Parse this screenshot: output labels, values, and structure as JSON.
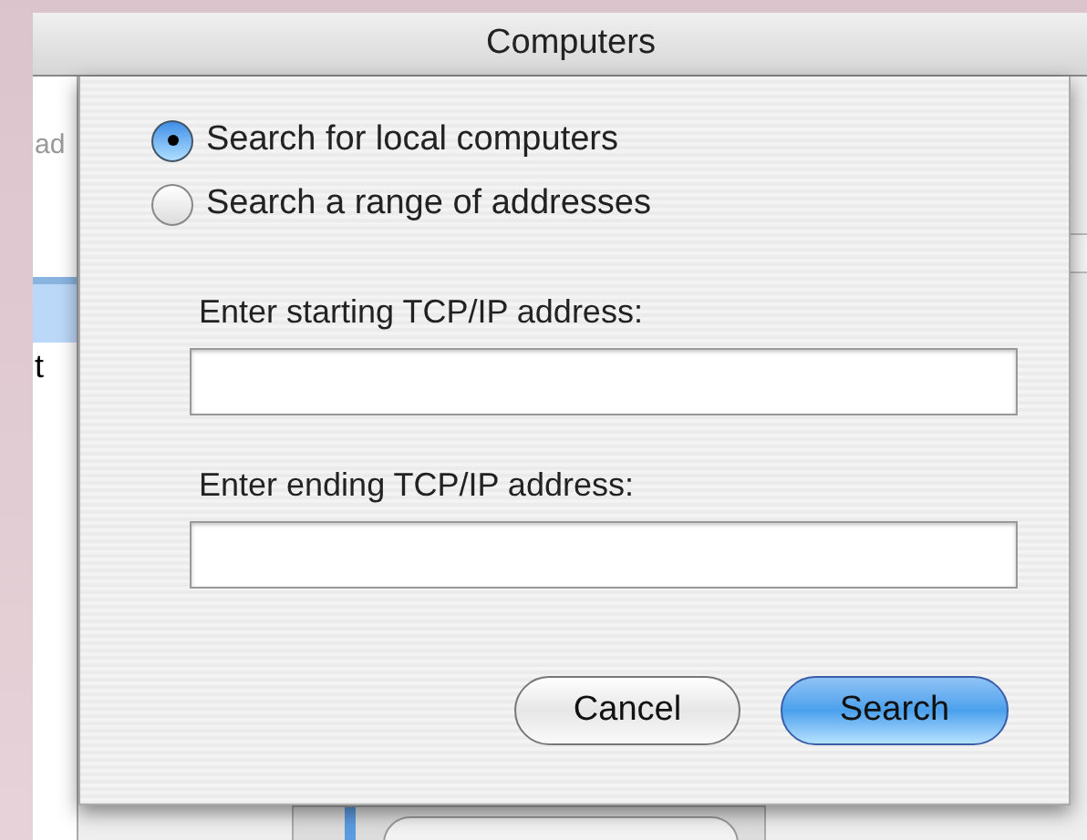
{
  "window": {
    "title": "Computers"
  },
  "background_window": {
    "left_column": {
      "header_text": "ad",
      "rows": [
        {
          "selected": true
        },
        {
          "selected": false,
          "text": "t"
        }
      ]
    }
  },
  "sheet": {
    "options": [
      {
        "label": "Search for local computers",
        "selected": true
      },
      {
        "label": "Search a range of addresses",
        "selected": false
      }
    ],
    "fields": [
      {
        "label": "Enter starting TCP/IP address:"
      },
      {
        "label": "Enter ending TCP/IP address:"
      }
    ],
    "buttons": [
      {
        "label": "Cancel",
        "default": false
      },
      {
        "label": "Search",
        "default": true
      }
    ]
  }
}
